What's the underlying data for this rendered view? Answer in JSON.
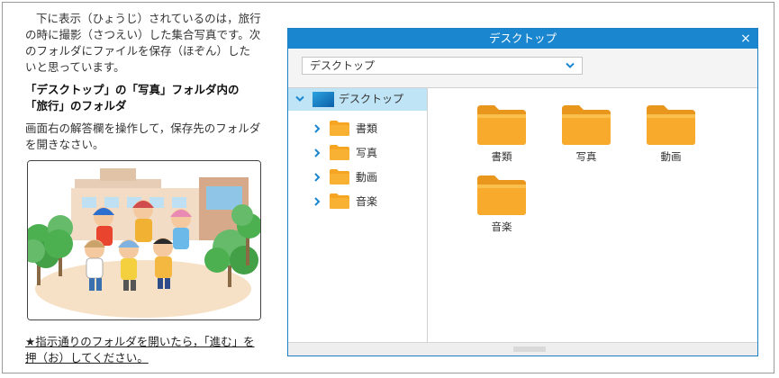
{
  "question": {
    "intro": "下に表示（ひょうじ）されているのは，旅行の時に撮影（さつえい）した集合写真です。次のフォルダにファイルを保存（ほぞん）したいと思っています。",
    "target": "「デスクトップ」の「写真」フォルダ内の「旅行」のフォルダ",
    "instruction": "画面右の解答欄を操作して，保存先のフォルダを開きなさい。",
    "note": "★指示通りのフォルダを開いたら，「進む」を押（お）してください。"
  },
  "window": {
    "title": "デスクトップ",
    "close_symbol": "×",
    "address_value": "デスクトップ",
    "tree": {
      "root_label": "デスクトップ",
      "items": [
        {
          "label": "書類"
        },
        {
          "label": "写真"
        },
        {
          "label": "動画"
        },
        {
          "label": "音楽"
        }
      ]
    },
    "folders": [
      {
        "label": "書類"
      },
      {
        "label": "写真"
      },
      {
        "label": "動画"
      },
      {
        "label": "音楽"
      }
    ]
  },
  "colors": {
    "titlebar": "#1a86d0",
    "tree_selected": "#bfe4f6",
    "folder": "#f6a523",
    "folder_dark": "#d98a14",
    "expander": "#1a86d0"
  },
  "icons": [
    "close-icon",
    "chevron-down-icon",
    "chevron-right-icon",
    "folder-icon",
    "desktop-icon",
    "resize-grip-icon"
  ]
}
